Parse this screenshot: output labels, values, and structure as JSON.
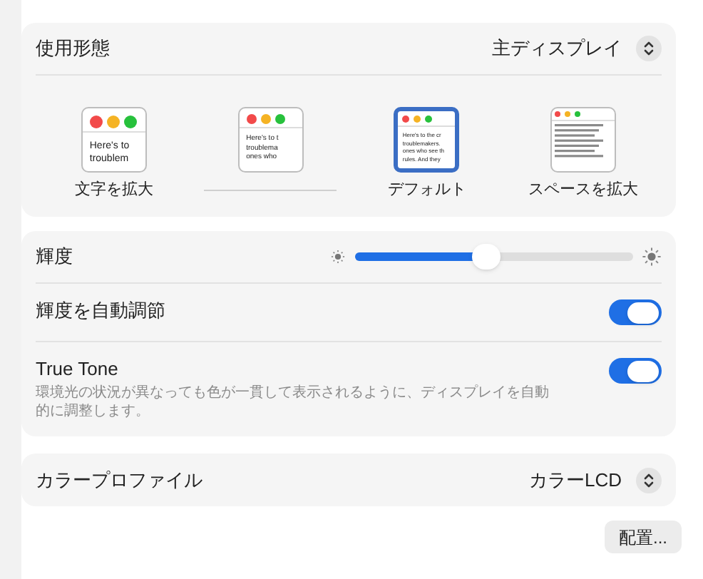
{
  "usage": {
    "label": "使用形態",
    "value": "主ディスプレイ",
    "options": [
      {
        "kind": "largest",
        "label": "文字を拡大",
        "selected": false,
        "lines": [
          "Here's to",
          "troublem"
        ]
      },
      {
        "kind": "large",
        "selected": false,
        "lines": [
          "Here's to t",
          "troublema",
          "ones who"
        ]
      },
      {
        "kind": "default",
        "label": "デフォルト",
        "selected": true,
        "lines": [
          "Here's to the cr",
          "troublemakers.",
          "ones who see th",
          "rules. And they"
        ]
      },
      {
        "kind": "more-space",
        "label": "スペースを拡大",
        "selected": false
      }
    ]
  },
  "brightness": {
    "label": "輝度",
    "level": 0.47
  },
  "toggles": [
    {
      "label": "輝度を自動調節",
      "on": true
    },
    {
      "label": "True Tone",
      "on": true,
      "description": "環境光の状況が異なっても色が一貫して表示されるように、ディスプレイを自動的に調整します。"
    }
  ],
  "color_profile": {
    "label": "カラープロファイル",
    "value": "カラーLCD"
  },
  "arrange_button": "配置..."
}
